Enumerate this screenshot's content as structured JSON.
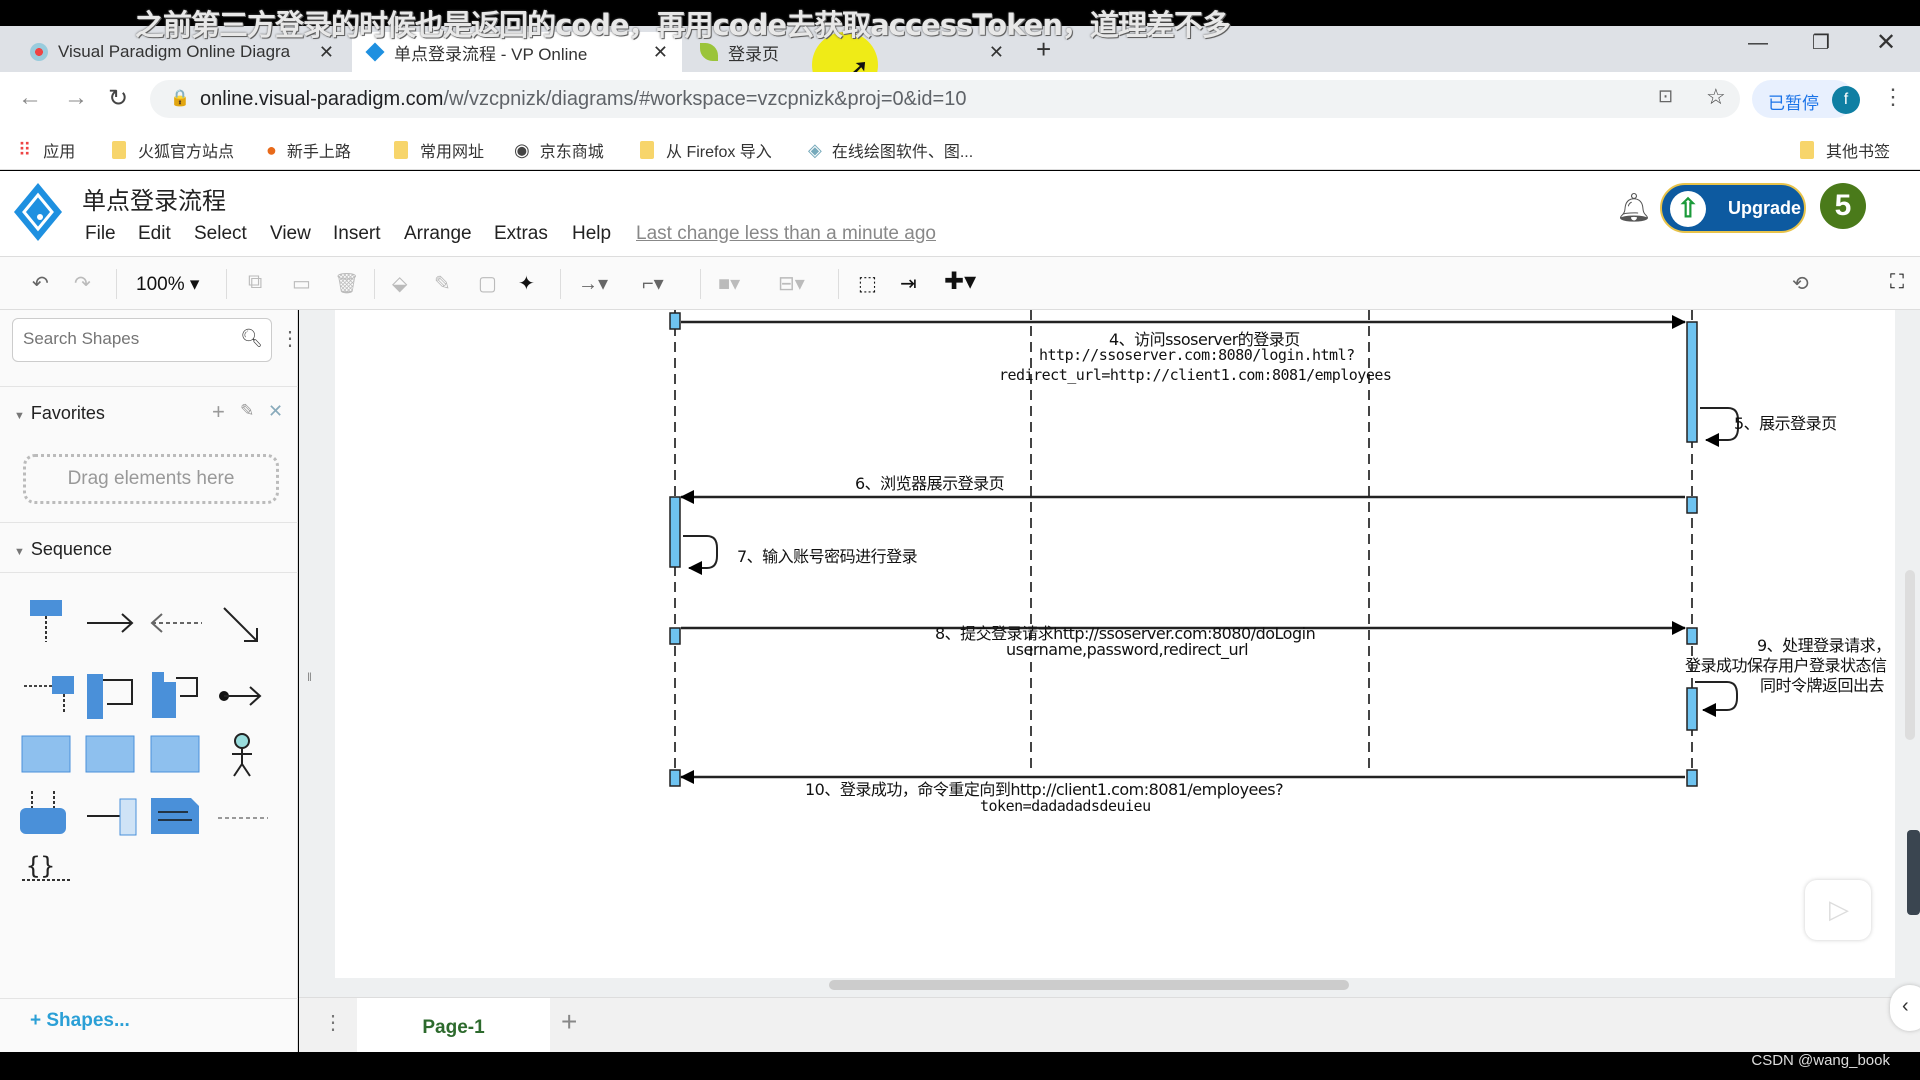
{
  "subtitle": "之前第三方登录的时候也是返回的code，再用code去获取accessToken，道理差不多",
  "browser": {
    "tabs": [
      {
        "title": "Visual Paradigm Online Diagra",
        "active": false
      },
      {
        "title": "单点登录流程 - VP Online",
        "active": true
      },
      {
        "title": "登录页",
        "active": false
      }
    ],
    "url_host": "online.visual-paradigm.com",
    "url_path": "/w/vzcpnizk/diagrams/#workspace=vzcpnizk&proj=0&id=10",
    "paused_label": "已暂停",
    "profile_initial": "f",
    "bookmarks": [
      "应用",
      "火狐官方站点",
      "新手上路",
      "常用网址",
      "京东商城",
      "从 Firefox 导入",
      "在线绘图软件、图..."
    ],
    "other_bookmarks": "其他书签"
  },
  "app": {
    "doc_title": "单点登录流程",
    "menus": [
      "File",
      "Edit",
      "Select",
      "View",
      "Insert",
      "Arrange",
      "Extras",
      "Help"
    ],
    "last_change": "Last change less than a minute ago",
    "upgrade_label": "Upgrade",
    "badge_count": "5",
    "zoom": "100%"
  },
  "sidebar": {
    "search_placeholder": "Search Shapes",
    "favorites_label": "Favorites",
    "drag_hint": "Drag elements here",
    "sequence_label": "Sequence",
    "shapes_button": "+ Shapes..."
  },
  "diagram": {
    "messages": [
      {
        "id": 4,
        "lines": [
          "4、访问ssoserver的登录页",
          "http://ssoserver.com:8080/login.html?",
          "redirect_url=http://client1.com:8081/employees"
        ],
        "from": "browser",
        "to": "ssoserver"
      },
      {
        "id": 5,
        "lines": [
          "5、展示登录页"
        ],
        "self": "ssoserver"
      },
      {
        "id": 6,
        "lines": [
          "6、浏览器展示登录页"
        ],
        "from": "ssoserver",
        "to": "browser"
      },
      {
        "id": 7,
        "lines": [
          "7、输入账号密码进行登录"
        ],
        "self": "browser"
      },
      {
        "id": 8,
        "lines": [
          "8、提交登录请求http://ssoserver.com:8080/doLogin",
          "username,password,redirect_url"
        ],
        "from": "browser",
        "to": "ssoserver"
      },
      {
        "id": 9,
        "lines": [
          "9、处理登录请求，",
          "登录成功保存用户登录状态信",
          "同时令牌返回出去"
        ],
        "self": "ssoserver"
      },
      {
        "id": 10,
        "lines": [
          "10、登录成功，命令重定向到http://client1.com:8081/employees?",
          "token=dadadadsdeuieu"
        ],
        "from": "ssoserver",
        "to": "browser"
      }
    ]
  },
  "pages": {
    "current": "Page-1"
  },
  "watermark": "CSDN @wang_book"
}
